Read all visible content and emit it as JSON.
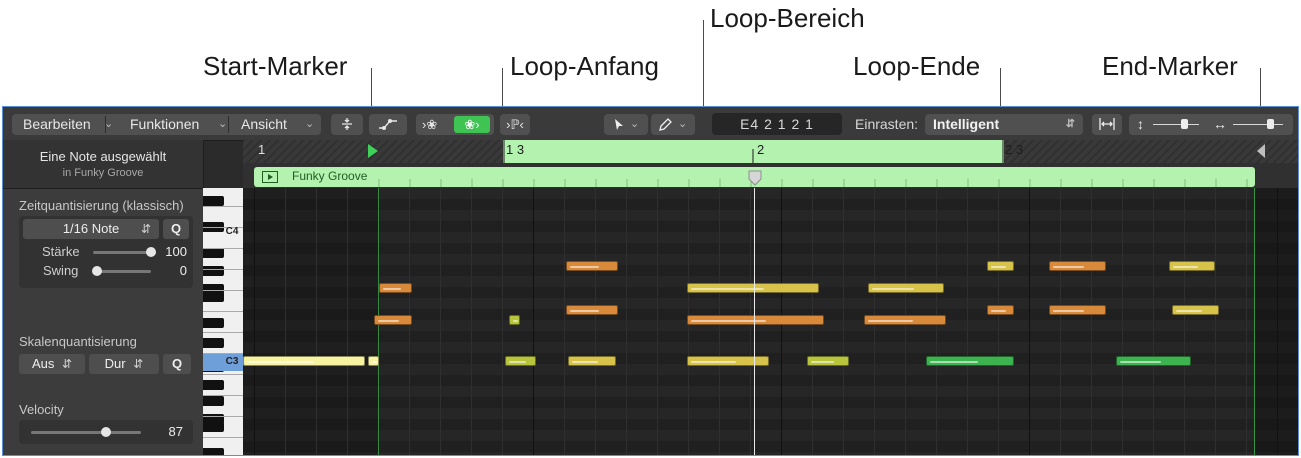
{
  "callouts": {
    "start_marker": "Start-Marker",
    "loop_start": "Loop-Anfang",
    "loop_range": "Loop-Bereich",
    "loop_end": "Loop-Ende",
    "end_marker": "End-Marker"
  },
  "toolbar": {
    "edit_menu": "Bearbeiten",
    "functions_menu": "Funktionen",
    "view_menu": "Ansicht",
    "position_display": "E4   2 1 2 1",
    "snap_label": "Einrasten:",
    "snap_value": "Intelligent"
  },
  "inspector": {
    "selection_title": "Eine Note ausgewählt",
    "selection_sub": "in Funky Groove",
    "time_quantize": {
      "label": "Zeitquantisierung (klassisch)",
      "value": "1/16 Note",
      "q_button": "Q",
      "strength_label": "Stärke",
      "strength_value": "100",
      "strength": 100,
      "swing_label": "Swing",
      "swing_value": "0",
      "swing": 0
    },
    "scale_quantize": {
      "label": "Skalenquantisierung",
      "off_value": "Aus",
      "mode_value": "Dur",
      "q_button": "Q"
    },
    "velocity": {
      "label": "Velocity",
      "value": "87",
      "level": 87
    }
  },
  "keyboard": {
    "c4_label": "C4",
    "c3_label": "C3"
  },
  "ruler": {
    "bar_1": "1",
    "bar_1_3": "1 3",
    "bar_2": "2",
    "bar_2_3": "2 3"
  },
  "region": {
    "name": "Funky Groove",
    "color": "#b4f2b0"
  },
  "colors": {
    "accent_green": "#3ec95a",
    "note_orange": "#d8893a",
    "note_yellow": "#d7c24a",
    "note_lime": "#b7c43c",
    "note_green": "#3db34f",
    "selected_note": "#f7f3a0"
  }
}
